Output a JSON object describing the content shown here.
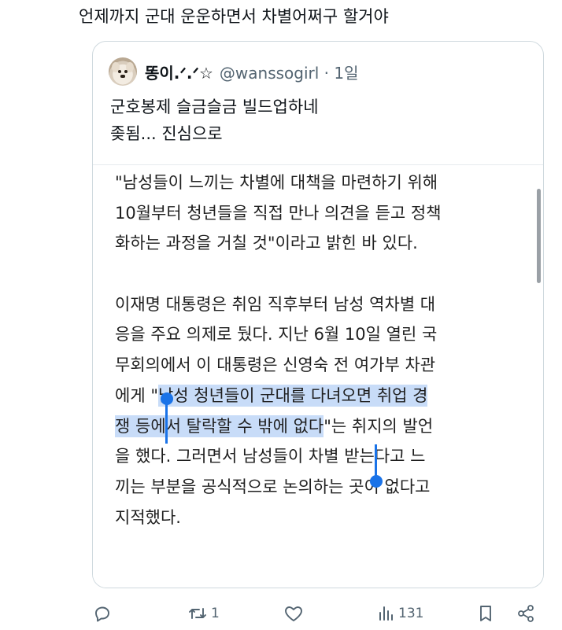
{
  "tweet": {
    "text": "언제까지 군대 운운하면서 차별어쩌구 할거야"
  },
  "quote": {
    "display_name": "똥이.ᐟ.ᐟ☆",
    "handle_time": "@wanssogirl · 1일",
    "body_lines": [
      "군호봉제 슬금슬금 빌드업하네",
      "좆됨... 진심으로"
    ],
    "article_lines": [
      "\"남성들이 느끼는 차별에 대책을 마련하기 위해",
      "10월부터 청년들을 직접 만나 의견을 듣고 정책",
      "화하는 과정을 거칠 것\"이라고 밝힌 바 있다.",
      "",
      "이재명 대통령은 취임 직후부터 남성 역차별 대",
      "응을 주요 의제로 뒀다. 지난 6월 10일 열린 국",
      "무회의에서 이 대통령은 신영숙 전 여가부 차관"
    ],
    "article_line8_prefix": "에게 \"",
    "article_line8_selected": "남성 청년들이 군대를 다녀오면 취업 경",
    "article_line9_selected": "쟁 등에서 탈락할 수 밖에 없다",
    "article_line9_suffix": "\"는 취지의 발언",
    "article_tail_lines": [
      "을 했다. 그러면서 남성들이 차별 받는다고 느",
      "끼는 부분을 공식적으로 논의하는 곳이 없다고",
      "지적했다."
    ]
  },
  "actions": {
    "reply_count": "",
    "retweet_count": "1",
    "like_count": "",
    "views_count": "131"
  },
  "icons": [
    "reply-icon",
    "retweet-icon",
    "like-icon",
    "views-icon",
    "bookmark-icon",
    "share-icon"
  ],
  "colors": {
    "text": "#0f1419",
    "secondary": "#536471",
    "selection": "#c8dcf8",
    "selection_handle": "#1a73e8"
  }
}
